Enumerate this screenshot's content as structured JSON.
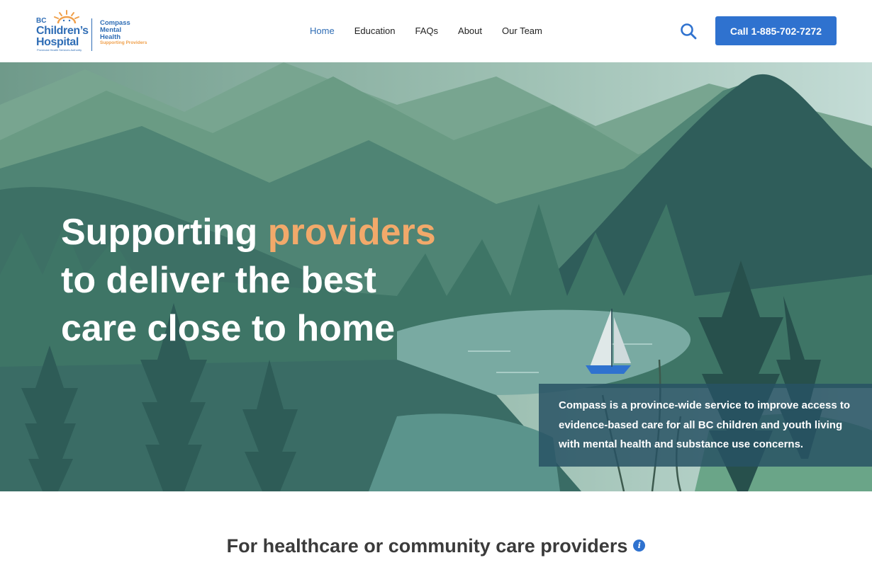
{
  "logo": {
    "bc": "BC",
    "childrens": "Children’s",
    "hospital": "Hospital",
    "pha": "Provincial Health Services Authority",
    "compass_line1": "Compass",
    "compass_line2": "Mental",
    "compass_line3": "Health",
    "supporting": "Supporting Providers"
  },
  "nav": {
    "items": [
      {
        "label": "Home",
        "active": true
      },
      {
        "label": "Education"
      },
      {
        "label": "FAQs"
      },
      {
        "label": "About"
      },
      {
        "label": "Our Team"
      }
    ]
  },
  "header": {
    "search_icon": "search-icon",
    "call_label": "Call 1-885-702-7272"
  },
  "hero": {
    "title_part1": "Supporting",
    "title_accent": "providers",
    "title_line2": "to deliver the best",
    "title_line3": "care close to home",
    "description": "Compass is a province-wide service to improve access to evidence-based care for all BC children and youth living with mental health and substance use concerns."
  },
  "section": {
    "heading": "For healthcare or community care providers",
    "info_icon": "i"
  },
  "colors": {
    "brand_blue": "#2f72cf",
    "accent_orange": "#f2a96a",
    "info_box": "#285264"
  }
}
